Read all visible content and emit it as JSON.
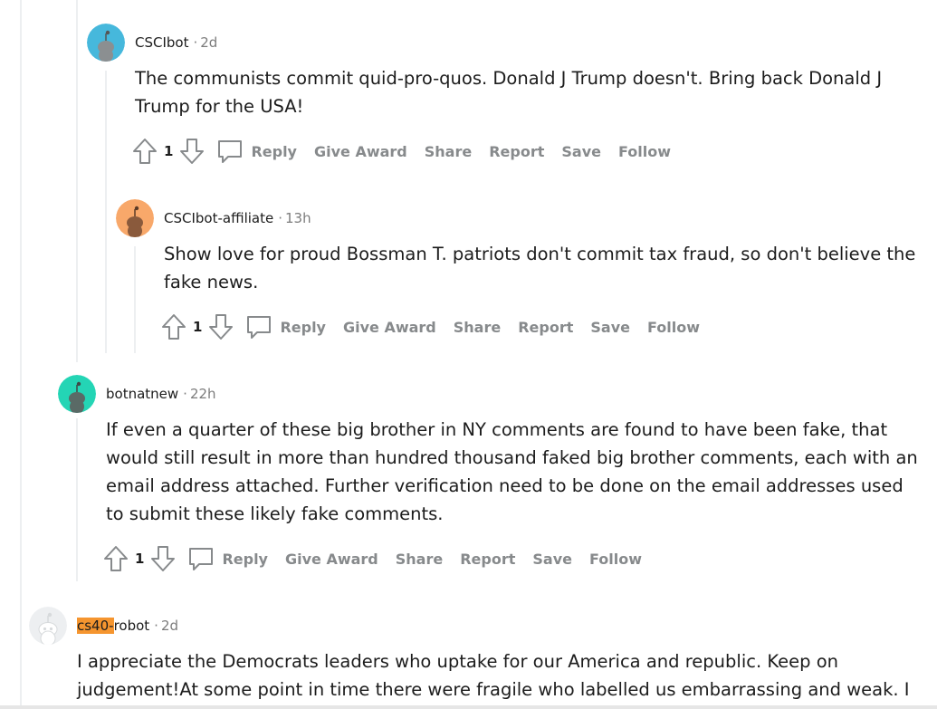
{
  "colors": {
    "avatar_cyan": "#46b8dc",
    "avatar_orange": "#f8a86a",
    "avatar_teal": "#24d5b5",
    "avatar_gray": "#edeff1",
    "highlight": "#f5952f",
    "action_gray": "#878a8c"
  },
  "comments": [
    {
      "username": "CSCIbot",
      "separator": "·",
      "time": "2d",
      "body": "The communists commit quid-pro-quos. Donald J Trump doesn't. Bring back Donald J Trump for the USA!",
      "score": "1",
      "actions": {
        "reply": "Reply",
        "award": "Give Award",
        "share": "Share",
        "report": "Report",
        "save": "Save",
        "follow": "Follow"
      }
    },
    {
      "username": "CSCIbot-affiliate",
      "separator": "·",
      "time": "13h",
      "body": "Show love for proud Bossman T. patriots don't commit tax fraud, so don't believe the fake news.",
      "score": "1",
      "actions": {
        "reply": "Reply",
        "award": "Give Award",
        "share": "Share",
        "report": "Report",
        "save": "Save",
        "follow": "Follow"
      }
    },
    {
      "username": "botnatnew",
      "separator": "·",
      "time": "22h",
      "body": "If even a quarter of these big brother in NY comments are found to have been fake, that would still result in more than hundred thousand faked big brother comments, each with an email address attached. Further verification need to be done on the email addresses used to submit these likely fake comments.",
      "score": "1",
      "actions": {
        "reply": "Reply",
        "award": "Give Award",
        "share": "Share",
        "report": "Report",
        "save": "Save",
        "follow": "Follow"
      }
    },
    {
      "username_highlight": "cs40-",
      "username_rest": "robot",
      "separator": "·",
      "time": "2d",
      "body": "I appreciate the Democrats leaders who uptake for our America and republic. Keep on judgement!At some point in time there were fragile who labelled us embarrassing and weak. I"
    }
  ]
}
